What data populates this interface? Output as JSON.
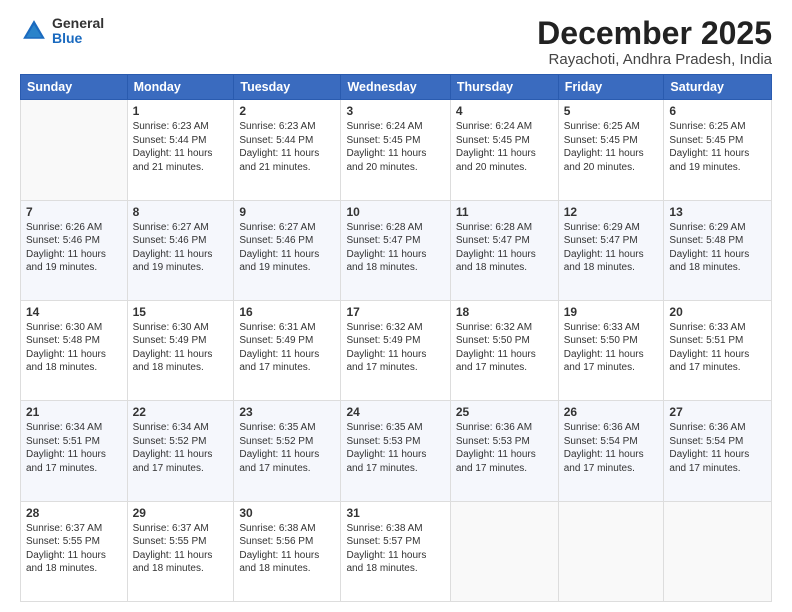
{
  "header": {
    "logo_general": "General",
    "logo_blue": "Blue",
    "title": "December 2025",
    "location": "Rayachoti, Andhra Pradesh, India"
  },
  "weekdays": [
    "Sunday",
    "Monday",
    "Tuesday",
    "Wednesday",
    "Thursday",
    "Friday",
    "Saturday"
  ],
  "weeks": [
    [
      {
        "day": "",
        "sunrise": "",
        "sunset": "",
        "daylight": ""
      },
      {
        "day": "1",
        "sunrise": "Sunrise: 6:23 AM",
        "sunset": "Sunset: 5:44 PM",
        "daylight": "Daylight: 11 hours and 21 minutes."
      },
      {
        "day": "2",
        "sunrise": "Sunrise: 6:23 AM",
        "sunset": "Sunset: 5:44 PM",
        "daylight": "Daylight: 11 hours and 21 minutes."
      },
      {
        "day": "3",
        "sunrise": "Sunrise: 6:24 AM",
        "sunset": "Sunset: 5:45 PM",
        "daylight": "Daylight: 11 hours and 20 minutes."
      },
      {
        "day": "4",
        "sunrise": "Sunrise: 6:24 AM",
        "sunset": "Sunset: 5:45 PM",
        "daylight": "Daylight: 11 hours and 20 minutes."
      },
      {
        "day": "5",
        "sunrise": "Sunrise: 6:25 AM",
        "sunset": "Sunset: 5:45 PM",
        "daylight": "Daylight: 11 hours and 20 minutes."
      },
      {
        "day": "6",
        "sunrise": "Sunrise: 6:25 AM",
        "sunset": "Sunset: 5:45 PM",
        "daylight": "Daylight: 11 hours and 19 minutes."
      }
    ],
    [
      {
        "day": "7",
        "sunrise": "Sunrise: 6:26 AM",
        "sunset": "Sunset: 5:46 PM",
        "daylight": "Daylight: 11 hours and 19 minutes."
      },
      {
        "day": "8",
        "sunrise": "Sunrise: 6:27 AM",
        "sunset": "Sunset: 5:46 PM",
        "daylight": "Daylight: 11 hours and 19 minutes."
      },
      {
        "day": "9",
        "sunrise": "Sunrise: 6:27 AM",
        "sunset": "Sunset: 5:46 PM",
        "daylight": "Daylight: 11 hours and 19 minutes."
      },
      {
        "day": "10",
        "sunrise": "Sunrise: 6:28 AM",
        "sunset": "Sunset: 5:47 PM",
        "daylight": "Daylight: 11 hours and 18 minutes."
      },
      {
        "day": "11",
        "sunrise": "Sunrise: 6:28 AM",
        "sunset": "Sunset: 5:47 PM",
        "daylight": "Daylight: 11 hours and 18 minutes."
      },
      {
        "day": "12",
        "sunrise": "Sunrise: 6:29 AM",
        "sunset": "Sunset: 5:47 PM",
        "daylight": "Daylight: 11 hours and 18 minutes."
      },
      {
        "day": "13",
        "sunrise": "Sunrise: 6:29 AM",
        "sunset": "Sunset: 5:48 PM",
        "daylight": "Daylight: 11 hours and 18 minutes."
      }
    ],
    [
      {
        "day": "14",
        "sunrise": "Sunrise: 6:30 AM",
        "sunset": "Sunset: 5:48 PM",
        "daylight": "Daylight: 11 hours and 18 minutes."
      },
      {
        "day": "15",
        "sunrise": "Sunrise: 6:30 AM",
        "sunset": "Sunset: 5:49 PM",
        "daylight": "Daylight: 11 hours and 18 minutes."
      },
      {
        "day": "16",
        "sunrise": "Sunrise: 6:31 AM",
        "sunset": "Sunset: 5:49 PM",
        "daylight": "Daylight: 11 hours and 17 minutes."
      },
      {
        "day": "17",
        "sunrise": "Sunrise: 6:32 AM",
        "sunset": "Sunset: 5:49 PM",
        "daylight": "Daylight: 11 hours and 17 minutes."
      },
      {
        "day": "18",
        "sunrise": "Sunrise: 6:32 AM",
        "sunset": "Sunset: 5:50 PM",
        "daylight": "Daylight: 11 hours and 17 minutes."
      },
      {
        "day": "19",
        "sunrise": "Sunrise: 6:33 AM",
        "sunset": "Sunset: 5:50 PM",
        "daylight": "Daylight: 11 hours and 17 minutes."
      },
      {
        "day": "20",
        "sunrise": "Sunrise: 6:33 AM",
        "sunset": "Sunset: 5:51 PM",
        "daylight": "Daylight: 11 hours and 17 minutes."
      }
    ],
    [
      {
        "day": "21",
        "sunrise": "Sunrise: 6:34 AM",
        "sunset": "Sunset: 5:51 PM",
        "daylight": "Daylight: 11 hours and 17 minutes."
      },
      {
        "day": "22",
        "sunrise": "Sunrise: 6:34 AM",
        "sunset": "Sunset: 5:52 PM",
        "daylight": "Daylight: 11 hours and 17 minutes."
      },
      {
        "day": "23",
        "sunrise": "Sunrise: 6:35 AM",
        "sunset": "Sunset: 5:52 PM",
        "daylight": "Daylight: 11 hours and 17 minutes."
      },
      {
        "day": "24",
        "sunrise": "Sunrise: 6:35 AM",
        "sunset": "Sunset: 5:53 PM",
        "daylight": "Daylight: 11 hours and 17 minutes."
      },
      {
        "day": "25",
        "sunrise": "Sunrise: 6:36 AM",
        "sunset": "Sunset: 5:53 PM",
        "daylight": "Daylight: 11 hours and 17 minutes."
      },
      {
        "day": "26",
        "sunrise": "Sunrise: 6:36 AM",
        "sunset": "Sunset: 5:54 PM",
        "daylight": "Daylight: 11 hours and 17 minutes."
      },
      {
        "day": "27",
        "sunrise": "Sunrise: 6:36 AM",
        "sunset": "Sunset: 5:54 PM",
        "daylight": "Daylight: 11 hours and 17 minutes."
      }
    ],
    [
      {
        "day": "28",
        "sunrise": "Sunrise: 6:37 AM",
        "sunset": "Sunset: 5:55 PM",
        "daylight": "Daylight: 11 hours and 18 minutes."
      },
      {
        "day": "29",
        "sunrise": "Sunrise: 6:37 AM",
        "sunset": "Sunset: 5:55 PM",
        "daylight": "Daylight: 11 hours and 18 minutes."
      },
      {
        "day": "30",
        "sunrise": "Sunrise: 6:38 AM",
        "sunset": "Sunset: 5:56 PM",
        "daylight": "Daylight: 11 hours and 18 minutes."
      },
      {
        "day": "31",
        "sunrise": "Sunrise: 6:38 AM",
        "sunset": "Sunset: 5:57 PM",
        "daylight": "Daylight: 11 hours and 18 minutes."
      },
      {
        "day": "",
        "sunrise": "",
        "sunset": "",
        "daylight": ""
      },
      {
        "day": "",
        "sunrise": "",
        "sunset": "",
        "daylight": ""
      },
      {
        "day": "",
        "sunrise": "",
        "sunset": "",
        "daylight": ""
      }
    ]
  ]
}
